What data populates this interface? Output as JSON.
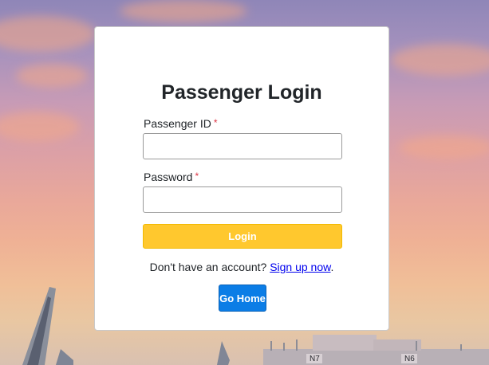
{
  "login": {
    "title": "Passenger Login",
    "passenger_id_label": "Passenger ID",
    "password_label": "Password",
    "required_mark": "*",
    "passenger_id_value": "",
    "password_value": "",
    "login_button": "Login",
    "signup_prefix": "Don't have an account?",
    "signup_link": "Sign up now",
    "signup_suffix": ".",
    "home_button": "Go Home"
  },
  "background": {
    "gate_signs": [
      "N7",
      "N6"
    ]
  },
  "colors": {
    "login_button": "#ffc82e",
    "home_button": "#0b7de6",
    "required": "#dc3545",
    "link": "#0000ee"
  }
}
